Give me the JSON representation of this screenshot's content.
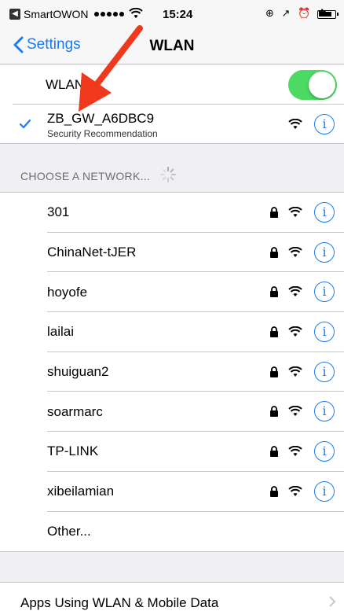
{
  "status_bar": {
    "carrier": "SmartOWON",
    "time": "15:24"
  },
  "nav": {
    "back_label": "Settings",
    "title": "WLAN"
  },
  "wlan_toggle": {
    "label": "WLAN",
    "on": true
  },
  "connected": {
    "name": "ZB_GW_A6DBC9",
    "subtitle": "Security Recommendation",
    "info": "i"
  },
  "section_header": "CHOOSE A NETWORK...",
  "networks": [
    {
      "name": "301",
      "secured": true,
      "info": "i"
    },
    {
      "name": "ChinaNet-tJER",
      "secured": true,
      "info": "i"
    },
    {
      "name": "hoyofe",
      "secured": true,
      "info": "i"
    },
    {
      "name": "lailai",
      "secured": true,
      "info": "i"
    },
    {
      "name": "shuiguan2",
      "secured": true,
      "info": "i"
    },
    {
      "name": "soarmarc",
      "secured": true,
      "info": "i"
    },
    {
      "name": "TP-LINK",
      "secured": true,
      "info": "i"
    },
    {
      "name": "xibeilamian",
      "secured": true,
      "info": "i"
    }
  ],
  "other_label": "Other...",
  "apps_label": "Apps Using WLAN & Mobile Data",
  "colors": {
    "accent": "#1a7cf5",
    "toggle_on": "#4cd964",
    "arrow": "#f0391c"
  }
}
